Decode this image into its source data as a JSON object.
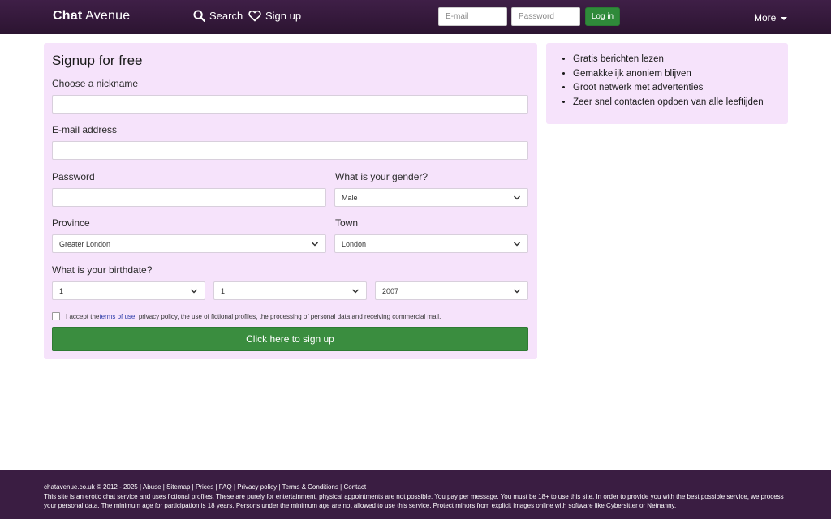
{
  "header": {
    "brand_bold": "Chat",
    "brand_rest": " Avenue",
    "search_label": "Search",
    "signup_label": "Sign up",
    "email_placeholder": "E-mail",
    "password_placeholder": "Password",
    "login_label": "Log in",
    "more_label": "More"
  },
  "signup": {
    "title": "Signup for free",
    "nickname_label": "Choose a nickname",
    "email_label": "E-mail address",
    "password_label": "Password",
    "gender_label": "What is your gender?",
    "gender_value": "Male",
    "province_label": "Province",
    "province_value": "Greater London",
    "town_label": "Town",
    "town_value": "London",
    "birthdate_label": "What is your birthdate?",
    "birth_day": "1",
    "birth_month": "1",
    "birth_year": "2007",
    "accept_prefix": "I accept the ",
    "accept_link": "terms of use",
    "accept_suffix": ", privacy policy, the use of fictional profiles, the processing of personal data and receiving commercial mail.",
    "button_label": "Click here to sign up"
  },
  "benefits": [
    "Gratis berichten lezen",
    "Gemakkelijk anoniem blijven",
    "Groot netwerk met advertenties",
    "Zeer snel contacten opdoen van alle leeftijden"
  ],
  "footer": {
    "copyright": "chatavenue.co.uk © 2012 - 2025",
    "links": [
      "Abuse",
      "Sitemap",
      "Prices",
      "FAQ",
      "Privacy policy",
      "Terms & Conditions",
      "Contact"
    ],
    "description": "This site is an erotic chat service and uses fictional profiles. These are purely for entertainment, physical appointments are not possible. You pay per message. You must be 18+ to use this site. In order to provide you with the best possible service, we process your personal data. The minimum age for participation is 18 years. Persons under the minimum age are not allowed to use this service. Protect minors from explicit images online with software like Cybersitter or Netnanny."
  },
  "colors": {
    "header_bg": "#2c1431",
    "panel_bg": "#f6e3fb",
    "button_green": "#3a8d3f",
    "footer_bg": "#3a1d42"
  },
  "icons": {
    "search": "search-icon",
    "signup": "heart-icon",
    "more": "caret-down-icon",
    "select": "chevron-down-icon"
  }
}
